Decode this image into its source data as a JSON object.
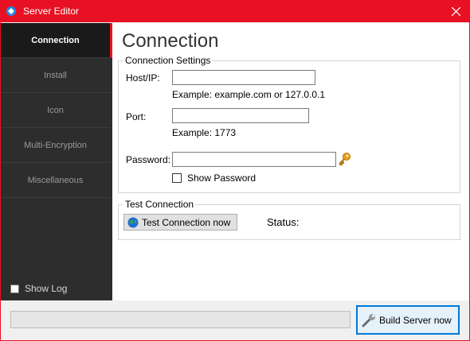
{
  "window": {
    "title": "Server Editor"
  },
  "sidebar": {
    "items": [
      {
        "label": "Connection",
        "active": true
      },
      {
        "label": "Install",
        "active": false
      },
      {
        "label": "Icon",
        "active": false
      },
      {
        "label": "Multi-Encryption",
        "active": false
      },
      {
        "label": "Miscellaneous",
        "active": false
      }
    ],
    "show_log_label": "Show Log",
    "show_log_checked": false
  },
  "main": {
    "title": "Connection",
    "connection_settings": {
      "group_label": "Connection Settings",
      "host_label": "Host/IP:",
      "host_value": "",
      "host_hint": "Example: example.com or 127.0.0.1",
      "port_label": "Port:",
      "port_value": "",
      "port_hint": "Example: 1773",
      "password_label": "Password:",
      "password_value": "",
      "show_password_label": "Show Password",
      "show_password_checked": false
    },
    "test_connection": {
      "group_label": "Test Connection",
      "button_label": "Test Connection now",
      "status_label": "Status:"
    }
  },
  "footer": {
    "progress": 0,
    "build_button_label": "Build Server now"
  },
  "colors": {
    "accent": "#e81123",
    "sidebar_bg": "#2d2d2d",
    "focus": "#0078d7"
  },
  "icons": {
    "app": "app-icon",
    "close": "close-icon",
    "key": "key-icon",
    "globe": "globe-icon",
    "build": "wrench-icon"
  }
}
